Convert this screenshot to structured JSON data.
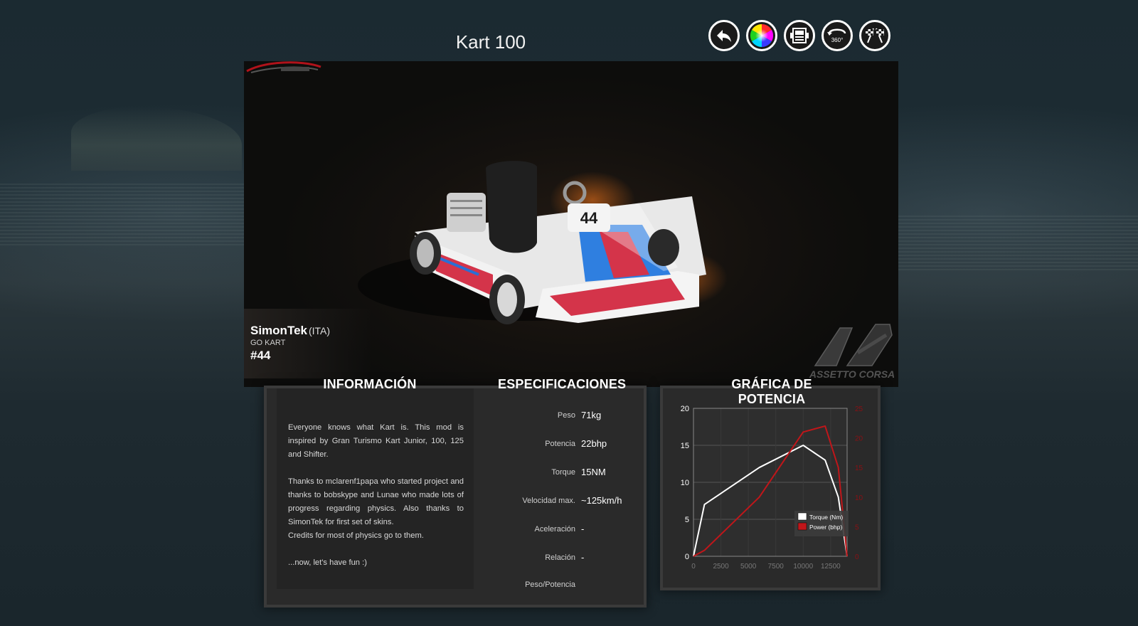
{
  "page": {
    "title": "Kart 100"
  },
  "toolbar": {
    "buttons": [
      {
        "name": "back-button",
        "icon": "back-arrow-icon"
      },
      {
        "name": "skin-color-button",
        "icon": "color-wheel-icon"
      },
      {
        "name": "showroom-button",
        "icon": "showroom-icon"
      },
      {
        "name": "view-360-button",
        "icon": "rotate-360-icon",
        "label": "360°"
      },
      {
        "name": "race-button",
        "icon": "checkered-flags-icon"
      }
    ]
  },
  "car_view": {
    "driver_name": "SimonTek",
    "driver_nationality": "(ITA)",
    "car_class": "GO KART",
    "car_number": "#44",
    "brand_watermark": "ASSETTO CORSA"
  },
  "sections": {
    "info_title": "INFORMACIÓN",
    "specs_title": "ESPECIFICACIONES",
    "chart_title": "GRÁFICA DE POTENCIA"
  },
  "info": {
    "paragraph1": "Everyone knows what Kart is. This mod is inspired by Gran Turismo Kart Junior, 100, 125 and Shifter.",
    "paragraph2a": "Thanks to mclarenf1papa who started project and thanks to bobskype and Lunae who made lots of progress regarding physics. Also thanks to SimonTek for first set of skins.",
    "paragraph2b": "Credits for most of physics go to them.",
    "paragraph3": "...now, let's have fun :)"
  },
  "specs": [
    {
      "label": "Peso",
      "value": "71kg"
    },
    {
      "label": "Potencia",
      "value": "22bhp"
    },
    {
      "label": "Torque",
      "value": "15NM"
    },
    {
      "label": "Velocidad max.",
      "value": "~125km/h"
    },
    {
      "label": "Aceleración",
      "value": "-"
    },
    {
      "label": "Relación",
      "value": "-"
    },
    {
      "label": "Peso/Potencia",
      "value": ""
    }
  ],
  "chart_data": {
    "type": "line",
    "x_ticks": [
      0,
      2500,
      5000,
      7500,
      10000,
      12500
    ],
    "xlim": [
      0,
      14000
    ],
    "y_left_ticks": [
      0,
      5,
      10,
      15,
      20
    ],
    "y_left_lim": [
      0,
      20
    ],
    "y_right_ticks": [
      0,
      5,
      10,
      15,
      20,
      25
    ],
    "y_right_lim": [
      0,
      25
    ],
    "grid": true,
    "legend_position": "bottom-right",
    "series": [
      {
        "name": "Torque (Nm)",
        "axis": "left",
        "color": "#ffffff",
        "x": [
          0,
          1000,
          6000,
          10000,
          12000,
          13200,
          14000
        ],
        "y": [
          0,
          7,
          12,
          15,
          13,
          8,
          0
        ]
      },
      {
        "name": "Power (bhp)",
        "axis": "right",
        "color": "#c0161a",
        "x": [
          0,
          1000,
          6000,
          10000,
          12000,
          13200,
          14000
        ],
        "y": [
          0,
          1,
          10,
          21,
          22,
          15,
          0
        ]
      }
    ]
  }
}
